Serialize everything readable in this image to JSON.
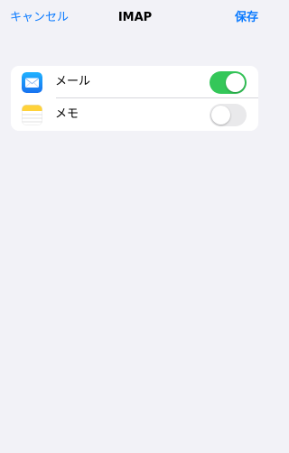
{
  "navbar": {
    "cancel_label": "キャンセル",
    "title": "IMAP",
    "save_label": "保存"
  },
  "settings": {
    "items": [
      {
        "label": "メール",
        "icon": "mail-app-icon",
        "enabled": true
      },
      {
        "label": "メモ",
        "icon": "notes-app-icon",
        "enabled": false
      }
    ]
  },
  "colors": {
    "accent": "#0a7aff",
    "toggle_on": "#34c759",
    "toggle_off": "#e9e9eb",
    "background": "#f2f2f7"
  }
}
